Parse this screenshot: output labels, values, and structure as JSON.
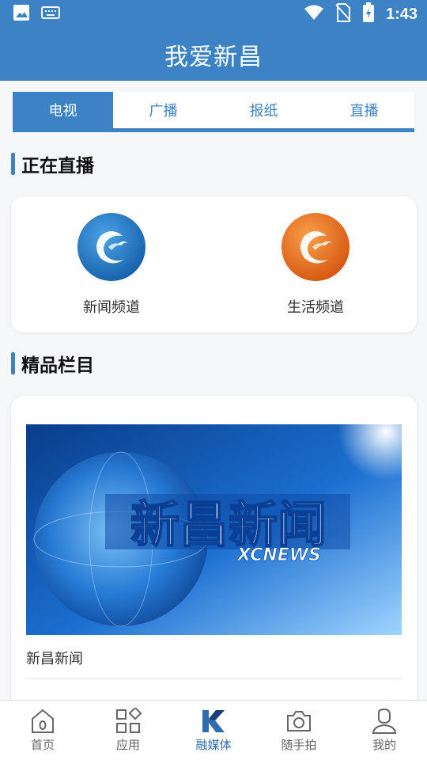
{
  "status_bar": {
    "time": "1:43",
    "icons": [
      "image-icon",
      "keyboard-icon",
      "wifi-icon",
      "no-sim-icon",
      "battery-icon"
    ]
  },
  "header": {
    "title": "我爱新昌"
  },
  "tabs": [
    {
      "label": "电视",
      "active": true
    },
    {
      "label": "广播",
      "active": false
    },
    {
      "label": "报纸",
      "active": false
    },
    {
      "label": "直播",
      "active": false
    }
  ],
  "live_section": {
    "title": "正在直播",
    "channels": [
      {
        "label": "新闻频道",
        "color": "#1f78c8"
      },
      {
        "label": "生活频道",
        "color": "#e8711a"
      }
    ]
  },
  "featured_section": {
    "title": "精品栏目",
    "program": {
      "banner_title": "新昌新闻",
      "banner_subtitle": "XCNEWS",
      "name": "新昌新闻"
    }
  },
  "bottom_nav": [
    {
      "label": "首页",
      "icon": "home-icon",
      "active": false
    },
    {
      "label": "应用",
      "icon": "apps-icon",
      "active": false
    },
    {
      "label": "融媒体",
      "icon": "media-logo-icon",
      "active": true
    },
    {
      "label": "随手拍",
      "icon": "camera-icon",
      "active": false
    },
    {
      "label": "我的",
      "icon": "profile-icon",
      "active": false
    }
  ],
  "colors": {
    "primary": "#3c82c4",
    "active_nav": "#2e6cae"
  }
}
